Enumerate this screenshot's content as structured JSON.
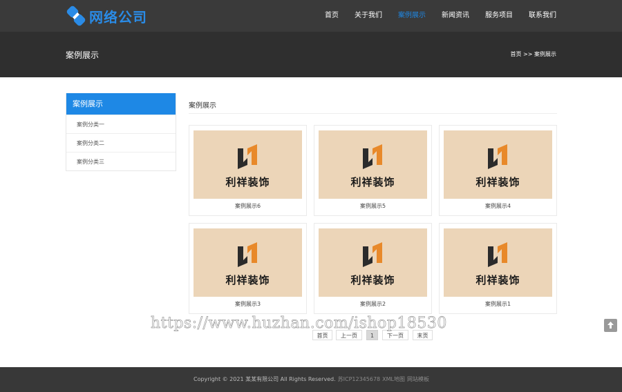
{
  "header": {
    "logo_text": "网络公司",
    "nav": [
      {
        "label": "首页",
        "active": false
      },
      {
        "label": "关于我们",
        "active": false
      },
      {
        "label": "案例展示",
        "active": true
      },
      {
        "label": "新闻资讯",
        "active": false
      },
      {
        "label": "服务项目",
        "active": false
      },
      {
        "label": "联系我们",
        "active": false
      }
    ]
  },
  "banner": {
    "title": "案例展示",
    "breadcrumb": "首页 >> 案例展示"
  },
  "sidebar": {
    "title": "案例展示",
    "items": [
      {
        "label": "案例分类一"
      },
      {
        "label": "案例分类二"
      },
      {
        "label": "案例分类三"
      }
    ]
  },
  "main": {
    "title": "案例展示",
    "cards": [
      {
        "thumb_text": "利祥装饰",
        "caption": "案例展示6"
      },
      {
        "thumb_text": "利祥装饰",
        "caption": "案例展示5"
      },
      {
        "thumb_text": "利祥装饰",
        "caption": "案例展示4"
      },
      {
        "thumb_text": "利祥装饰",
        "caption": "案例展示3"
      },
      {
        "thumb_text": "利祥装饰",
        "caption": "案例展示2"
      },
      {
        "thumb_text": "利祥装饰",
        "caption": "案例展示1"
      }
    ]
  },
  "pagination": {
    "first": "首页",
    "prev": "上一页",
    "current": "1",
    "next": "下一页",
    "last": "末页"
  },
  "watermark": "https://www.huzhan.com/ishop18530",
  "footer": {
    "copyright": "Copyright © 2021 某某有限公司 All Rights Reserved.",
    "icp": "苏ICP12345678",
    "links": [
      "XML地图",
      "网站模板"
    ]
  },
  "colors": {
    "accent": "#1e88e5",
    "header_bg": "#3a3a3a",
    "banner_bg": "#2f2f2f",
    "thumb_bg": "#ecd5b8",
    "logo_orange": "#e8892a"
  },
  "icons": {
    "logo": "brand-logo-icon",
    "thumb": "lixiang-logo-icon",
    "back_to_top": "arrow-up-icon"
  }
}
